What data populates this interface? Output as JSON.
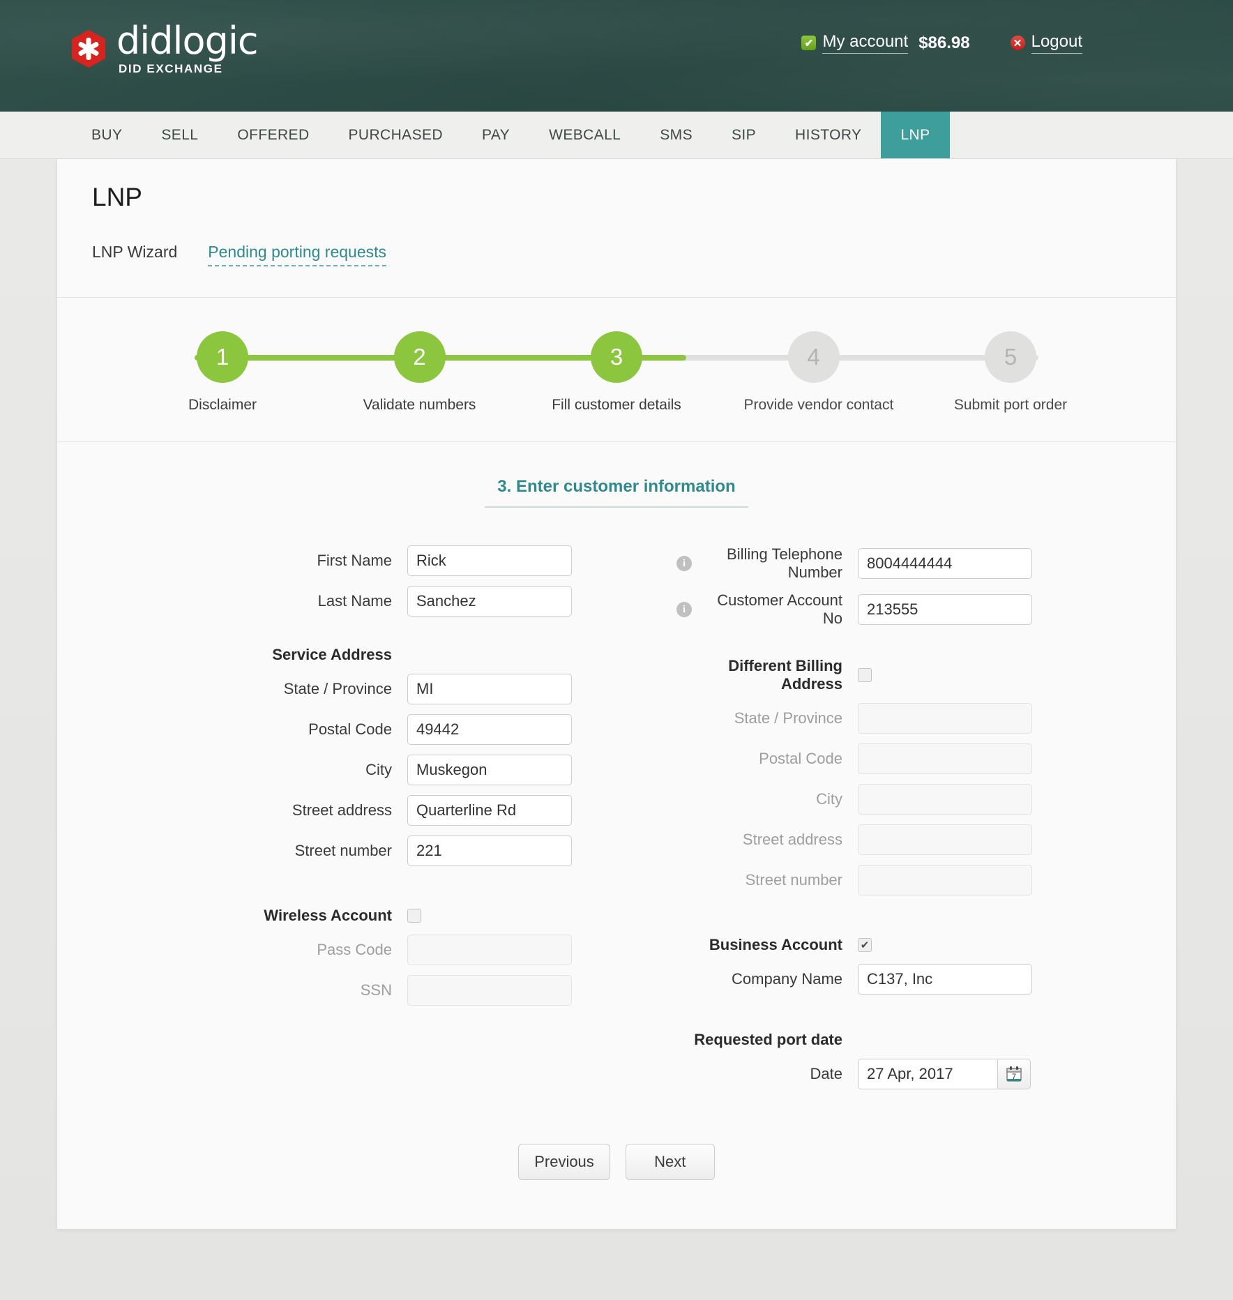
{
  "header": {
    "brand_name": "didlogic",
    "brand_sub": "DID EXCHANGE",
    "account_label": "My account",
    "account_balance": "$86.98",
    "logout_label": "Logout",
    "check_icon": "check-icon",
    "x_icon": "close-icon",
    "bg_color": "#2d4b46"
  },
  "nav": {
    "items": [
      {
        "label": "BUY",
        "active": false
      },
      {
        "label": "SELL",
        "active": false
      },
      {
        "label": "OFFERED",
        "active": false
      },
      {
        "label": "PURCHASED",
        "active": false
      },
      {
        "label": "PAY",
        "active": false
      },
      {
        "label": "WEBCALL",
        "active": false
      },
      {
        "label": "SMS",
        "active": false
      },
      {
        "label": "SIP",
        "active": false
      },
      {
        "label": "HISTORY",
        "active": false
      },
      {
        "label": "LNP",
        "active": true
      }
    ],
    "active_color": "#3d9e9c"
  },
  "page": {
    "title": "LNP",
    "subtabs": [
      {
        "label": "LNP Wizard",
        "style": "plain"
      },
      {
        "label": "Pending porting requests",
        "style": "link"
      }
    ],
    "link_color": "#2f8a8d"
  },
  "steps": {
    "progress_color": "#8cc63f",
    "inactive_color": "#e0e0de",
    "items": [
      {
        "number": "1",
        "label": "Disclaimer",
        "done": true
      },
      {
        "number": "2",
        "label": "Validate numbers",
        "done": true
      },
      {
        "number": "3",
        "label": "Fill customer details",
        "done": true
      },
      {
        "number": "4",
        "label": "Provide vendor contact",
        "done": false
      },
      {
        "number": "5",
        "label": "Submit port order",
        "done": false
      }
    ]
  },
  "form": {
    "section_title": "3. Enter customer information",
    "left": {
      "first_name_label": "First Name",
      "first_name_value": "Rick",
      "last_name_label": "Last Name",
      "last_name_value": "Sanchez",
      "service_address_label": "Service Address",
      "state_label": "State / Province",
      "state_value": "MI",
      "postal_label": "Postal Code",
      "postal_value": "49442",
      "city_label": "City",
      "city_value": "Muskegon",
      "street_address_label": "Street address",
      "street_address_value": "Quarterline Rd",
      "street_number_label": "Street number",
      "street_number_value": "221",
      "wireless_label": "Wireless Account",
      "wireless_checked": false,
      "passcode_label": "Pass Code",
      "passcode_value": "",
      "ssn_label": "SSN",
      "ssn_value": ""
    },
    "right": {
      "btn_label": "Billing Telephone Number",
      "btn_value": "8004444444",
      "account_no_label": "Customer Account No",
      "account_no_value": "213555",
      "different_billing_label": "Different Billing Address",
      "different_billing_checked": false,
      "state_label": "State / Province",
      "state_value": "",
      "postal_label": "Postal Code",
      "postal_value": "",
      "city_label": "City",
      "city_value": "",
      "street_address_label": "Street address",
      "street_address_value": "",
      "street_number_label": "Street number",
      "street_number_value": "",
      "business_label": "Business Account",
      "business_checked": true,
      "company_label": "Company Name",
      "company_value": "C137, Inc",
      "port_date_label": "Requested port date",
      "date_label": "Date",
      "date_value": "27 Apr, 2017",
      "calendar_icon": "calendar-icon",
      "calendar_day": "7"
    },
    "buttons": {
      "previous": "Previous",
      "next": "Next"
    }
  }
}
